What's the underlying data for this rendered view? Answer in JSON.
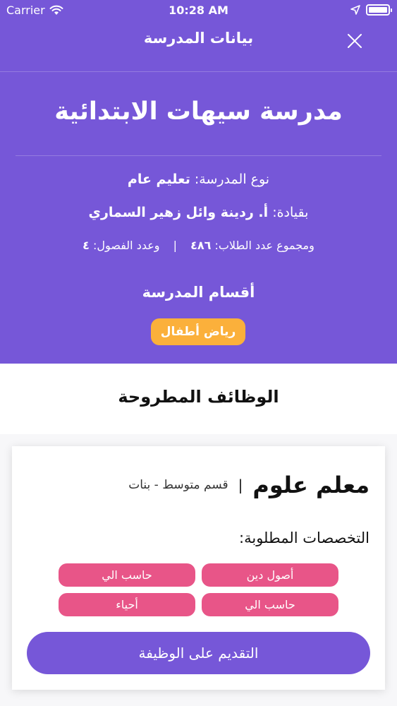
{
  "status_bar": {
    "carrier": "Carrier",
    "time": "10:28 AM",
    "icons": [
      "wifi-icon",
      "location-arrow-icon",
      "battery-icon"
    ]
  },
  "nav": {
    "title": "بيانات المدرسة",
    "close_icon": "close-icon"
  },
  "school": {
    "name": "مدرسة سيهات الابتدائية",
    "type_label": "نوع المدرسة:",
    "type_value": "تعليم عام",
    "leader_label": "بقيادة:",
    "leader_value": "أ. ردينة وائل زهير السماري",
    "students_label": "ومجموع عدد الطلاب:",
    "students_value": "٤٨٦",
    "separator": "|",
    "classes_label": "وعدد الفصول:",
    "classes_value": "٤"
  },
  "sections": {
    "title": "أقسام المدرسة",
    "items": [
      "رياض أطفال"
    ]
  },
  "jobs": {
    "title": "الوظائف المطروحة",
    "items": [
      {
        "name": "معلم علوم",
        "separator": "|",
        "department": "قسم متوسط - بنات",
        "specs_label": "التخصصات المطلوبة:",
        "specs": [
          "أصول دين",
          "حاسب الي",
          "حاسب الي",
          "أحياء"
        ],
        "apply_label": "التقديم على الوظيفة"
      }
    ]
  },
  "colors": {
    "primary": "#7657d8",
    "section_chip": "#fbb03b",
    "spec_chip": "#e85588"
  }
}
